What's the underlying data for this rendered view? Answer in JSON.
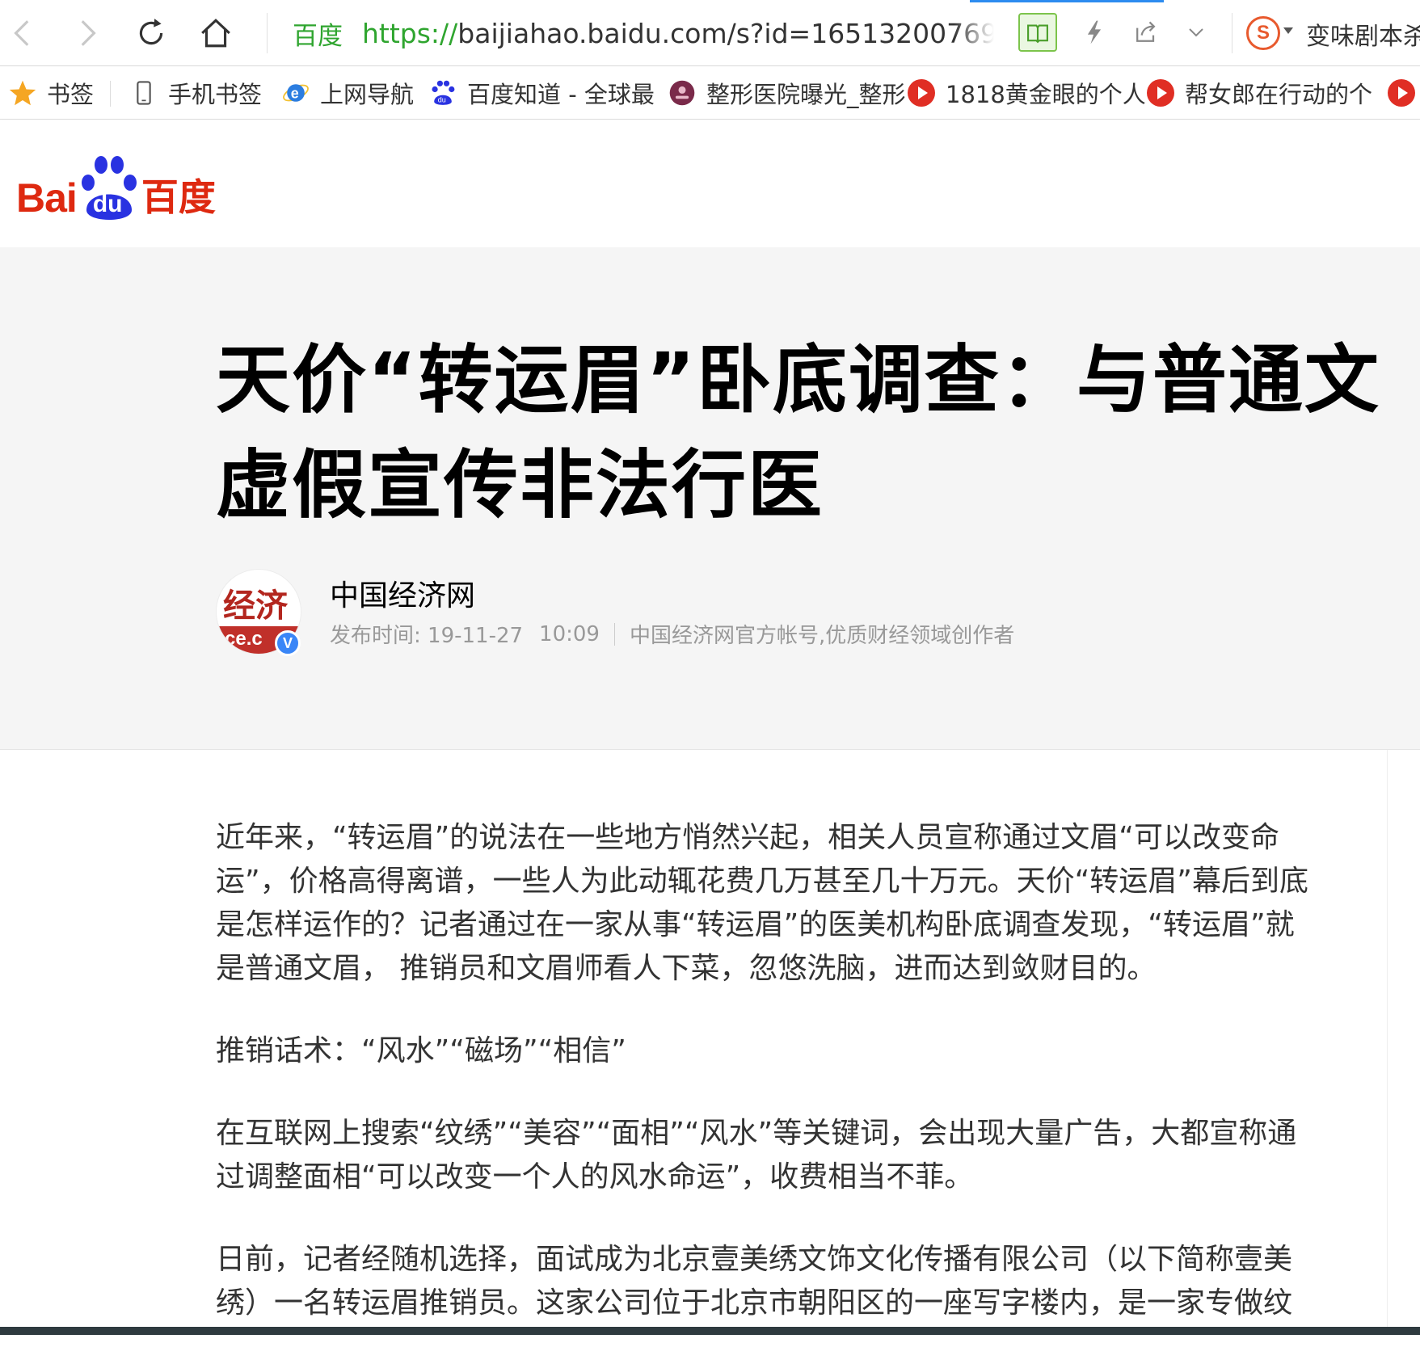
{
  "browser": {
    "address_site_label": "百度",
    "url_protocol": "https://",
    "url_rest": "baijiahao.baidu.com/s?id=16513200769(",
    "extension_text": "变味剧本杀",
    "icons": [
      "back-icon",
      "forward-icon",
      "reload-icon",
      "home-icon",
      "star-icon",
      "reader-icon",
      "lightning-icon",
      "share-icon",
      "chevron-down-icon",
      "sogou-icon"
    ]
  },
  "bookmarks": [
    {
      "label": "书签",
      "icon": "star-icon"
    },
    {
      "label": "手机书签",
      "icon": "phone-icon"
    },
    {
      "label": "上网导航",
      "icon": "ie-icon"
    },
    {
      "label": "百度知道 - 全球最",
      "icon": "baidu-paw-icon"
    },
    {
      "label": "整形医院曝光_整形",
      "icon": "site-icon"
    },
    {
      "label": "1818黄金眼的个人",
      "icon": "video-icon"
    },
    {
      "label": "帮女郎在行动的个",
      "icon": "video-icon"
    }
  ],
  "site": {
    "logo_text_left": "Bai",
    "logo_text_paw": "du",
    "logo_text_right": "百度"
  },
  "article": {
    "title_line1": "天价“转运眉”卧底调查：与普通文",
    "title_line2": "虚假宣传非法行医",
    "author": "中国经济网",
    "avatar_text": "ce.c",
    "avatar_calligraphy": "经济",
    "publish_label": "发布时间: 19-11-27",
    "publish_time": "10:09",
    "author_desc": "中国经济网官方帐号,优质财经领域创作者",
    "paragraphs": [
      "近年来，“转运眉”的说法在一些地方悄然兴起，相关人员宣称通过文眉“可以改变命运”，价格高得离谱，一些人为此动辄花费几万甚至几十万元。天价“转运眉”幕后到底是怎样运作的？记者通过在一家从事“转运眉”的医美机构卧底调查发现，“转运眉”就是普通文眉， 推销员和文眉师看人下菜，忽悠洗脑，进而达到敛财目的。",
      "推销话术：“风水”“磁场”“相信”",
      "在互联网上搜索“纹绣”“美容”“面相”“风水”等关键词，会出现大量广告，大都宣称通过调整面相“可以改变一个人的风水命运”，收费相当不菲。",
      "日前，记者经随机选择，面试成为北京壹美绣文饰文化传播有限公司（以下简称壹美绣）一名转运眉推销员。这家公司位于北京市朝阳区的一座写字楼内，是一家专做纹"
    ]
  },
  "colors": {
    "baidu_red": "#de2910",
    "baidu_blue": "#2932e1",
    "url_green": "#2fa52f",
    "verified_blue": "#3a86f7"
  }
}
